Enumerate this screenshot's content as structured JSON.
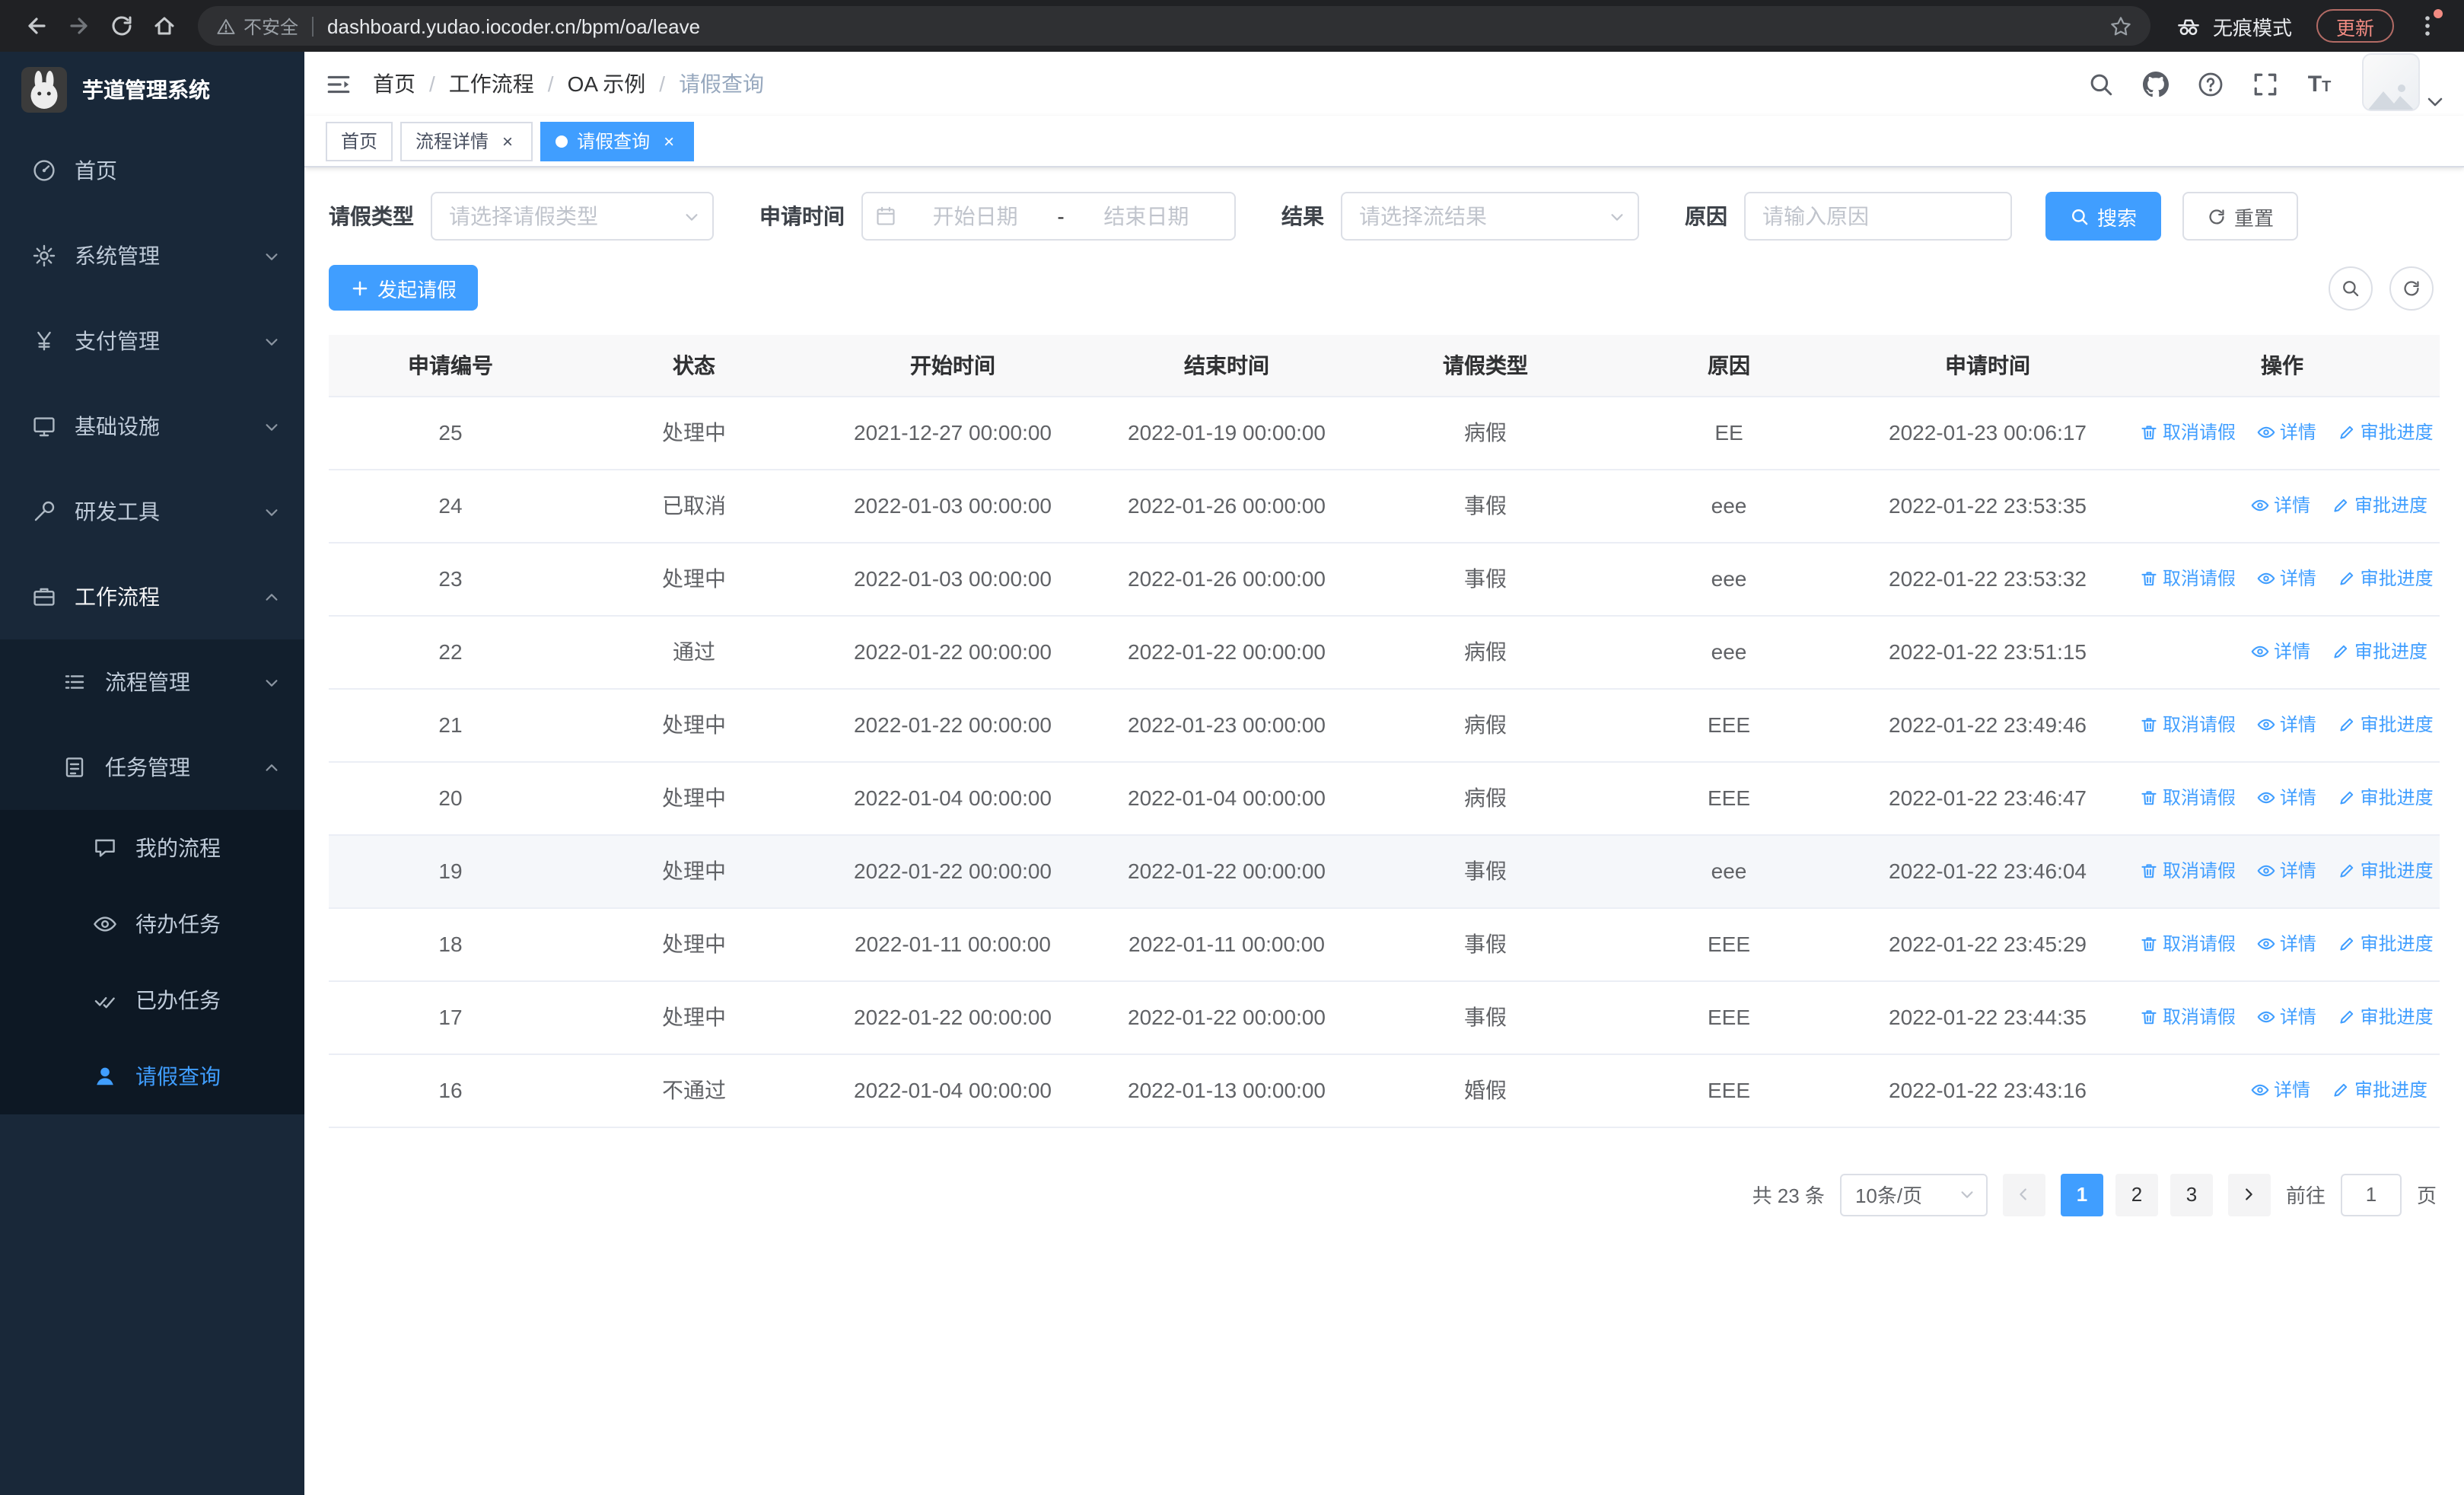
{
  "browser": {
    "security_label": "不安全",
    "url": "dashboard.yudao.iocoder.cn/bpm/oa/leave",
    "incognito_label": "无痕模式",
    "update_label": "更新"
  },
  "sidebar": {
    "logo_title": "芋道管理系统",
    "menu": {
      "home": "首页",
      "system": "系统管理",
      "payment": "支付管理",
      "infra": "基础设施",
      "devtools": "研发工具",
      "workflow": "工作流程",
      "process": "流程管理",
      "task": "任务管理",
      "my_process": "我的流程",
      "todo": "待办任务",
      "done": "已办任务",
      "leave": "请假查询"
    }
  },
  "header": {
    "breadcrumb": [
      "首页",
      "工作流程",
      "OA 示例",
      "请假查询"
    ]
  },
  "tabs": [
    {
      "label": "首页"
    },
    {
      "label": "流程详情"
    },
    {
      "label": "请假查询"
    }
  ],
  "filters": {
    "leave_type_label": "请假类型",
    "leave_type_placeholder": "请选择请假类型",
    "apply_time_label": "申请时间",
    "start_placeholder": "开始日期",
    "separator": "-",
    "end_placeholder": "结束日期",
    "result_label": "结果",
    "result_placeholder": "请选择流结果",
    "reason_label": "原因",
    "reason_placeholder": "请输入原因",
    "search_label": "搜索",
    "reset_label": "重置"
  },
  "toolbar": {
    "create_label": "发起请假"
  },
  "table": {
    "columns": [
      "申请编号",
      "状态",
      "开始时间",
      "结束时间",
      "请假类型",
      "原因",
      "申请时间",
      "操作"
    ],
    "rows": [
      {
        "id": "25",
        "status": "处理中",
        "start": "2021-12-27 00:00:00",
        "end": "2022-01-19 00:00:00",
        "type": "病假",
        "reason": "EE",
        "apply_time": "2022-01-23 00:06:17",
        "actions": [
          "取消请假",
          "详情",
          "审批进度"
        ]
      },
      {
        "id": "24",
        "status": "已取消",
        "start": "2022-01-03 00:00:00",
        "end": "2022-01-26 00:00:00",
        "type": "事假",
        "reason": "eee",
        "apply_time": "2022-01-22 23:53:35",
        "actions": [
          "详情",
          "审批进度"
        ]
      },
      {
        "id": "23",
        "status": "处理中",
        "start": "2022-01-03 00:00:00",
        "end": "2022-01-26 00:00:00",
        "type": "事假",
        "reason": "eee",
        "apply_time": "2022-01-22 23:53:32",
        "actions": [
          "取消请假",
          "详情",
          "审批进度"
        ]
      },
      {
        "id": "22",
        "status": "通过",
        "start": "2022-01-22 00:00:00",
        "end": "2022-01-22 00:00:00",
        "type": "病假",
        "reason": "eee",
        "apply_time": "2022-01-22 23:51:15",
        "actions": [
          "详情",
          "审批进度"
        ]
      },
      {
        "id": "21",
        "status": "处理中",
        "start": "2022-01-22 00:00:00",
        "end": "2022-01-23 00:00:00",
        "type": "病假",
        "reason": "EEE",
        "apply_time": "2022-01-22 23:49:46",
        "actions": [
          "取消请假",
          "详情",
          "审批进度"
        ]
      },
      {
        "id": "20",
        "status": "处理中",
        "start": "2022-01-04 00:00:00",
        "end": "2022-01-04 00:00:00",
        "type": "病假",
        "reason": "EEE",
        "apply_time": "2022-01-22 23:46:47",
        "actions": [
          "取消请假",
          "详情",
          "审批进度"
        ]
      },
      {
        "id": "19",
        "status": "处理中",
        "start": "2022-01-22 00:00:00",
        "end": "2022-01-22 00:00:00",
        "type": "事假",
        "reason": "eee",
        "apply_time": "2022-01-22 23:46:04",
        "actions": [
          "取消请假",
          "详情",
          "审批进度"
        ]
      },
      {
        "id": "18",
        "status": "处理中",
        "start": "2022-01-11 00:00:00",
        "end": "2022-01-11 00:00:00",
        "type": "事假",
        "reason": "EEE",
        "apply_time": "2022-01-22 23:45:29",
        "actions": [
          "取消请假",
          "详情",
          "审批进度"
        ]
      },
      {
        "id": "17",
        "status": "处理中",
        "start": "2022-01-22 00:00:00",
        "end": "2022-01-22 00:00:00",
        "type": "事假",
        "reason": "EEE",
        "apply_time": "2022-01-22 23:44:35",
        "actions": [
          "取消请假",
          "详情",
          "审批进度"
        ]
      },
      {
        "id": "16",
        "status": "不通过",
        "start": "2022-01-04 00:00:00",
        "end": "2022-01-13 00:00:00",
        "type": "婚假",
        "reason": "EEE",
        "apply_time": "2022-01-22 23:43:16",
        "actions": [
          "详情",
          "审批进度"
        ]
      }
    ]
  },
  "pagination": {
    "total": "共 23 条",
    "page_size": "10条/页",
    "pages": [
      "1",
      "2",
      "3"
    ],
    "goto_label": "前往",
    "goto_value": "1",
    "page_unit": "页"
  }
}
